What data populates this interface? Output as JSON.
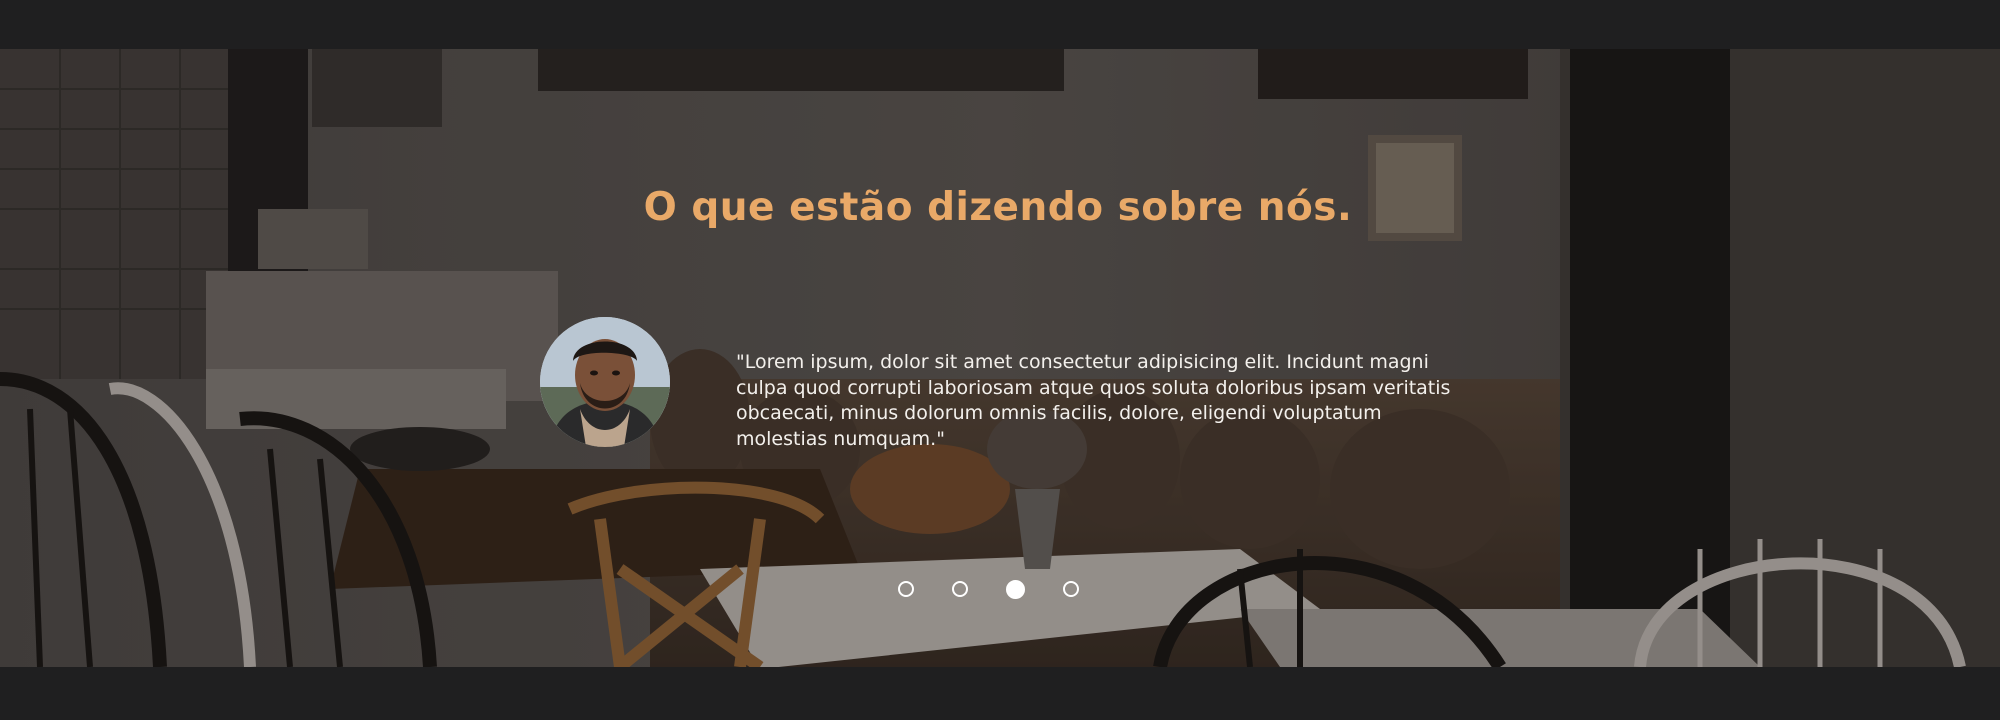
{
  "testimonials": {
    "title": "O que estão dizendo sobre nós.",
    "quote": "\"Lorem ipsum, dolor sit amet consectetur adipisicing elit. Incidunt magni culpa quod corrupti laboriosam atque quos soluta doloribus ipsam veritatis obcaecati, minus dolorum omnis facilis, dolore, eligendi voluptatum molestias numquam.\"",
    "slides": 4,
    "active_slide": 3
  },
  "colors": {
    "page_bg": "#1f1f20",
    "title": "#e9a968",
    "quote_text": "#f3f0ec",
    "dot": "#ffffff"
  },
  "icons": {
    "carousel_dot": "circle-outline",
    "carousel_dot_active": "circle-filled"
  }
}
